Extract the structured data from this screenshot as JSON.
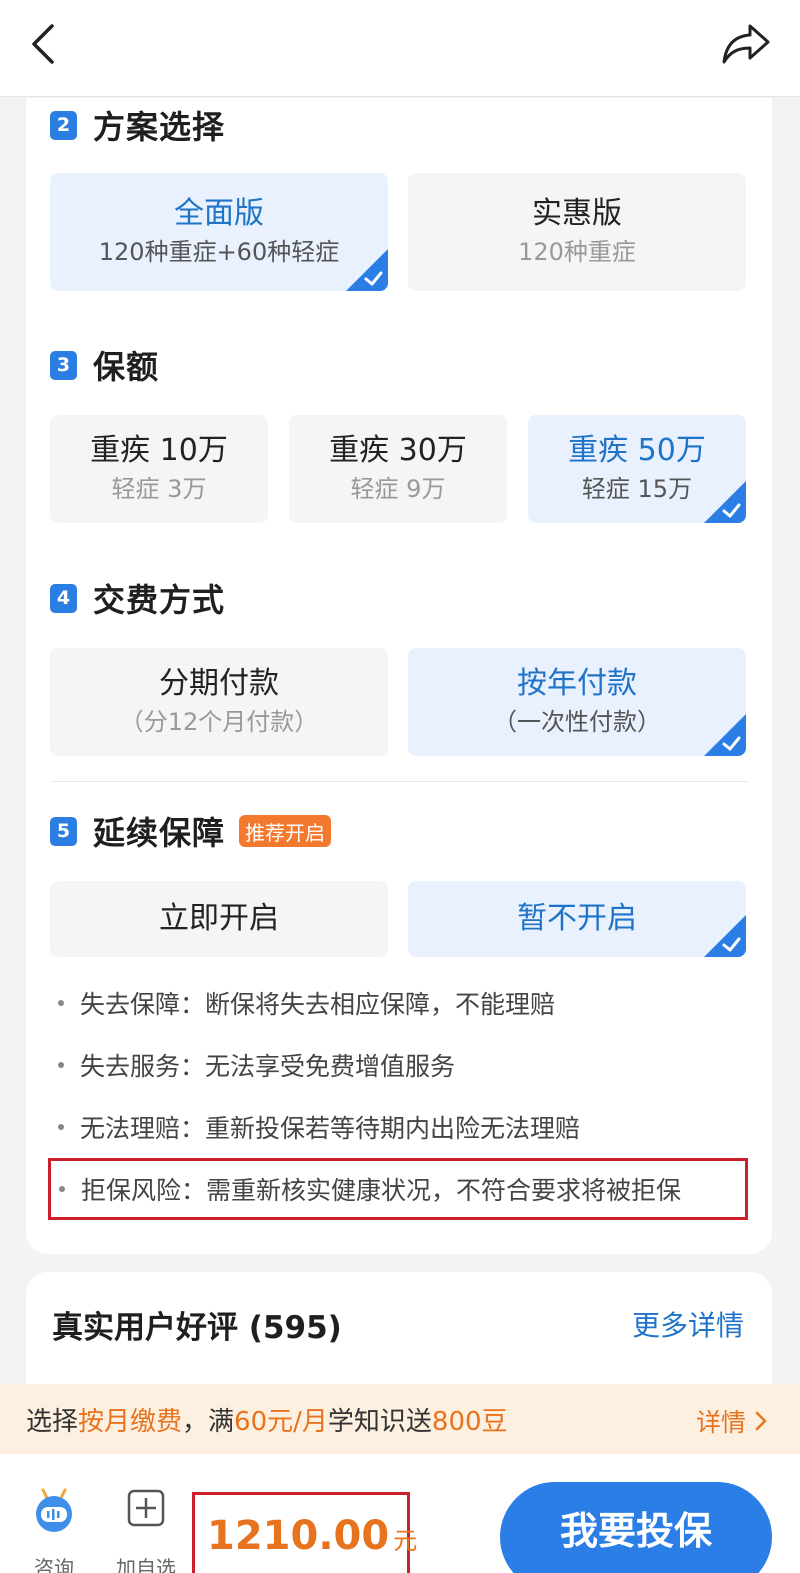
{
  "nav": {
    "back_icon": "chevron-left-icon",
    "share_icon": "share-arrow-icon"
  },
  "sections": {
    "plan": {
      "num": "2",
      "title": "方案选择",
      "options": [
        {
          "main": "全面版",
          "sub": "120种重症+60种轻症",
          "selected": true
        },
        {
          "main": "实惠版",
          "sub": "120种重症",
          "selected": false
        }
      ]
    },
    "coverage": {
      "num": "3",
      "title": "保额",
      "options": [
        {
          "main": "重疾 10万",
          "sub": "轻症 3万",
          "selected": false
        },
        {
          "main": "重疾 30万",
          "sub": "轻症 9万",
          "selected": false
        },
        {
          "main": "重疾 50万",
          "sub": "轻症 15万",
          "selected": true
        }
      ]
    },
    "payment": {
      "num": "4",
      "title": "交费方式",
      "options": [
        {
          "main": "分期付款",
          "sub": "（分12个月付款）",
          "selected": false
        },
        {
          "main": "按年付款",
          "sub": "（一次性付款）",
          "selected": true
        }
      ]
    },
    "renewal": {
      "num": "5",
      "title": "延续保障",
      "tag": "推荐开启",
      "options": [
        {
          "main": "立即开启",
          "selected": false
        },
        {
          "main": "暂不开启",
          "selected": true
        }
      ],
      "bullets": [
        "失去保障：断保将失去相应保障，不能理赔",
        "失去服务：无法享受免费增值服务",
        "无法理赔：重新投保若等待期内出险无法理赔",
        "拒保风险：需重新核实健康状况，不符合要求将被拒保"
      ]
    }
  },
  "reviews": {
    "title": "真实用户好评 (595)",
    "more": "更多详情"
  },
  "promo": {
    "p1": "选择",
    "p2": "按月缴费",
    "p3": "，满",
    "p4": "60元/月",
    "p5": "学知识送",
    "p6": "800豆",
    "link": "详情"
  },
  "bottom": {
    "consult": "咨询",
    "add": "加自选",
    "price": "1210.00",
    "unit": "元",
    "buy": "我要投保"
  },
  "colors": {
    "accent": "#2b7ee6",
    "selected_bg": "#e8f1fd",
    "price": "#e8731f",
    "highlight_border": "#cc1f2c"
  }
}
